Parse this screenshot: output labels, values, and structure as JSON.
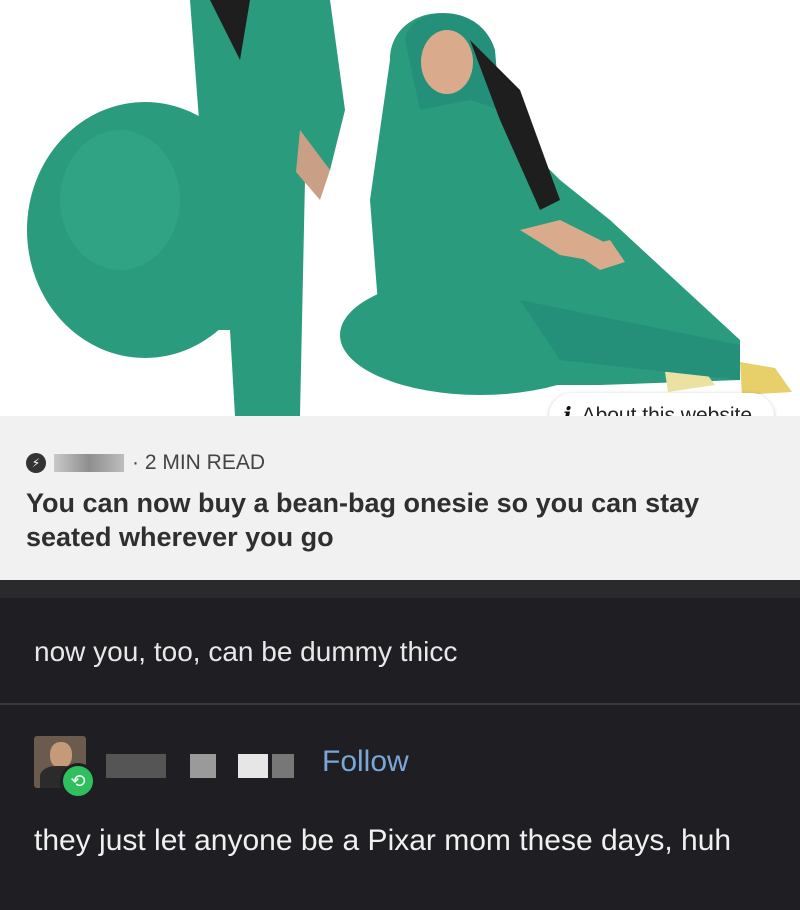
{
  "preview": {
    "about_label": "About this website",
    "about_icon": "info-icon",
    "source_icon": "source-logo-icon",
    "read_time": "· 2 MIN READ",
    "headline": "You can now buy a bean-bag onesie so you can stay seated wherever you go"
  },
  "post": {
    "text": "now you, too, can be dummy thicc"
  },
  "reply": {
    "follow_label": "Follow",
    "reblog_icon": "reblog-icon",
    "comment": "they just let anyone be a Pixar mom these days, huh"
  },
  "colors": {
    "onesie": "#2a9b7c",
    "dark_bg": "#1f1e22",
    "follow_link": "#7aa7d6",
    "reblog_badge": "#2fbf5f"
  }
}
